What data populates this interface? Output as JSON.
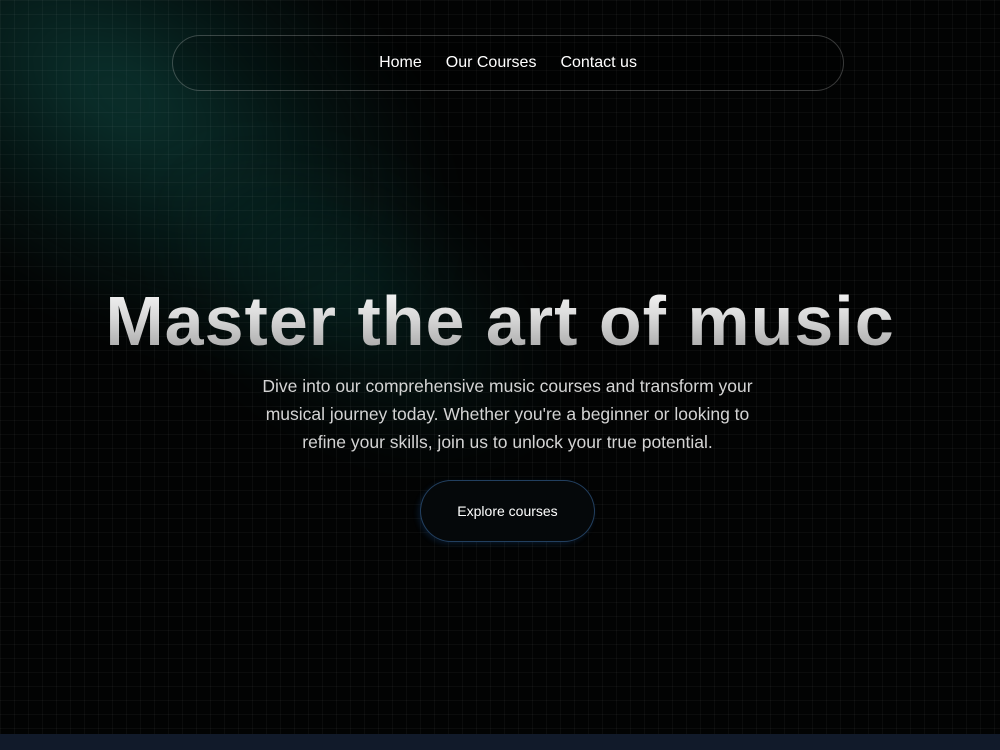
{
  "nav": {
    "items": [
      {
        "label": "Home"
      },
      {
        "label": "Our Courses"
      },
      {
        "label": "Contact us"
      }
    ]
  },
  "hero": {
    "title": "Master the art of music",
    "description": "Dive into our comprehensive music courses and transform your musical journey today. Whether you're a beginner or looking to refine your skills, join us to unlock your true potential.",
    "cta_label": "Explore courses"
  },
  "colors": {
    "background": "#020303",
    "accent_glow": "#125850",
    "footer": "#111a2a",
    "button_border": "#4682c8"
  }
}
